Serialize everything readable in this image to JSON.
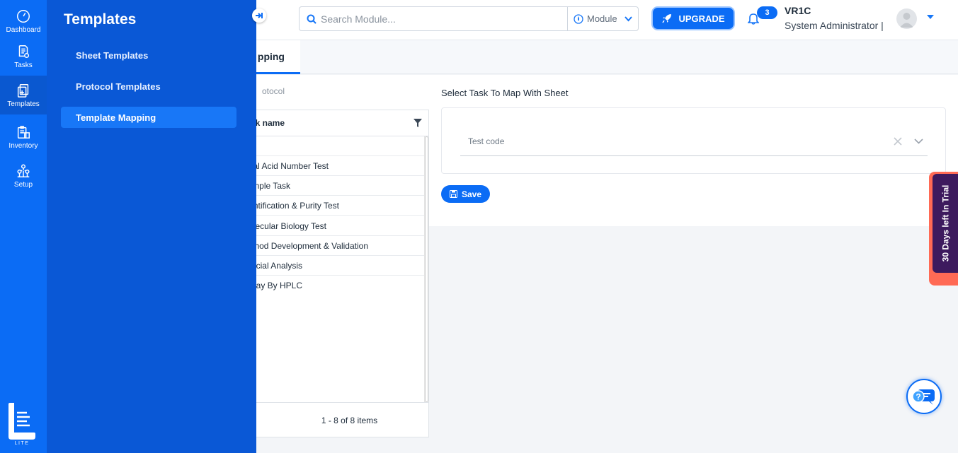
{
  "rail": {
    "items": [
      {
        "label": "Dashboard",
        "icon": "dashboard-icon"
      },
      {
        "label": "Tasks",
        "icon": "tasks-icon"
      },
      {
        "label": "Templates",
        "icon": "templates-icon"
      },
      {
        "label": "Inventory",
        "icon": "inventory-icon"
      },
      {
        "label": "Setup",
        "icon": "setup-icon"
      }
    ],
    "logo_text": "LITE"
  },
  "flyout": {
    "title": "Templates",
    "items": [
      {
        "label": "Sheet Templates"
      },
      {
        "label": "Protocol Templates"
      },
      {
        "label": "Template Mapping"
      }
    ]
  },
  "header": {
    "search_placeholder": "Search Module...",
    "module_label": "Module",
    "upgrade_label": "UPGRADE",
    "notification_count": "3",
    "user_name": "VR1C",
    "user_role": "System Administrator |"
  },
  "tab": {
    "label": "pping"
  },
  "grid": {
    "section_label": "otocol",
    "header": "sk name",
    "rows": [
      "",
      "al Acid Number Test",
      "mple Task",
      "ntification & Purity Test",
      "ecular Biology Test",
      "thod Development & Validation",
      "cial Analysis",
      "ay By HPLC"
    ],
    "pager": "1 - 8 of 8 items"
  },
  "mapping": {
    "title": "Select Task To Map With Sheet",
    "placeholder": "Test code",
    "save_label": "Save"
  },
  "trial": {
    "text": "30 Days left In Trial"
  },
  "colors": {
    "primary": "#0b6cf5",
    "flyout": "#0a58d6",
    "trial_bg": "#3d1a5e",
    "trial_accent": "#ff6a55"
  }
}
